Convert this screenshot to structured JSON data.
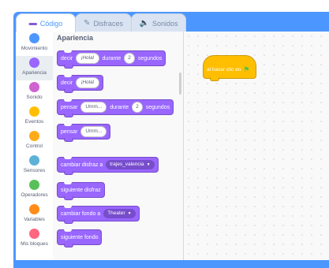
{
  "tabs": [
    {
      "label": "Código",
      "icon": "code-icon"
    },
    {
      "label": "Disfraces",
      "icon": "brush-icon"
    },
    {
      "label": "Sonidos",
      "icon": "speaker-icon"
    }
  ],
  "categories": [
    {
      "label": "Movimiento",
      "color": "#4c97ff"
    },
    {
      "label": "Apariencia",
      "color": "#9966ff"
    },
    {
      "label": "Sonido",
      "color": "#cf63cf"
    },
    {
      "label": "Eventos",
      "color": "#ffbf00"
    },
    {
      "label": "Control",
      "color": "#ffab19"
    },
    {
      "label": "Sensores",
      "color": "#5cb1d6"
    },
    {
      "label": "Operadores",
      "color": "#59c059"
    },
    {
      "label": "Variables",
      "color": "#ff8c1a"
    },
    {
      "label": "Mis bloques",
      "color": "#ff6680"
    }
  ],
  "palette": {
    "title": "Apariencia",
    "blocks": {
      "say_for": {
        "text1": "decir",
        "value": "¡Hola!",
        "text2": "durante",
        "num": "2",
        "text3": "segundos"
      },
      "say": {
        "text1": "decir",
        "value": "¡Hola!"
      },
      "think_for": {
        "text1": "pensar",
        "value": "Umm...",
        "text2": "durante",
        "num": "2",
        "text3": "segundos"
      },
      "think": {
        "text1": "pensar",
        "value": "Umm..."
      },
      "switch_costume": {
        "text1": "cambiar disfraz a",
        "dropdown": "trajes_valencia"
      },
      "next_costume": {
        "text1": "siguiente disfraz"
      },
      "switch_backdrop": {
        "text1": "cambiar fondo a",
        "dropdown": "Theater"
      },
      "next_backdrop": {
        "text1": "siguiente fondo"
      }
    }
  },
  "script": {
    "hat_label": "al hacer clic en"
  }
}
